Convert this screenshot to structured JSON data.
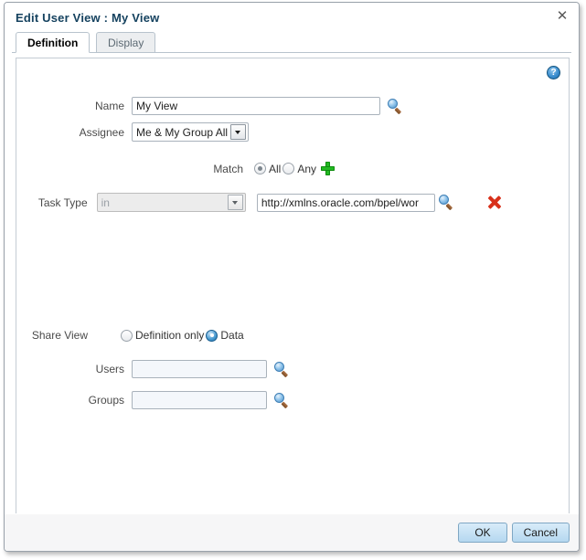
{
  "dialog": {
    "title": "Edit User View : My View",
    "close_icon": "close-icon",
    "close_glyph": "✕"
  },
  "tabs": [
    {
      "label": "Definition",
      "active": true
    },
    {
      "label": "Display",
      "active": false
    }
  ],
  "help": {
    "icon": "help-icon",
    "glyph": "?"
  },
  "form": {
    "name": {
      "label": "Name",
      "value": "My View",
      "placeholder": "",
      "search_icon": "magnifier-icon"
    },
    "assignee": {
      "label": "Assignee",
      "value": "Me & My Group All"
    },
    "match": {
      "label": "Match",
      "options": [
        {
          "label": "All",
          "selected": true
        },
        {
          "label": "Any",
          "selected": false
        }
      ],
      "add_icon": "plus-icon"
    },
    "task_type": {
      "label": "Task Type",
      "operator": "in",
      "operator_disabled": true,
      "value": "http://xmlns.oracle.com/bpel/wor",
      "search_icon": "magnifier-icon",
      "delete_icon": "delete-icon"
    },
    "share_view": {
      "label": "Share View",
      "options": [
        {
          "label": "Definition only",
          "selected": false
        },
        {
          "label": "Data",
          "selected": true
        }
      ]
    },
    "users": {
      "label": "Users",
      "value": "",
      "placeholder": "",
      "search_icon": "magnifier-icon"
    },
    "groups": {
      "label": "Groups",
      "value": "",
      "placeholder": "",
      "search_icon": "magnifier-icon"
    }
  },
  "footer": {
    "ok_label": "OK",
    "cancel_label": "Cancel"
  },
  "colors": {
    "title": "#15425f",
    "accent_blue": "#4a90c8",
    "add_green": "#22b922",
    "delete_red": "#d8301a",
    "button_blue": "#b5d8f0"
  }
}
